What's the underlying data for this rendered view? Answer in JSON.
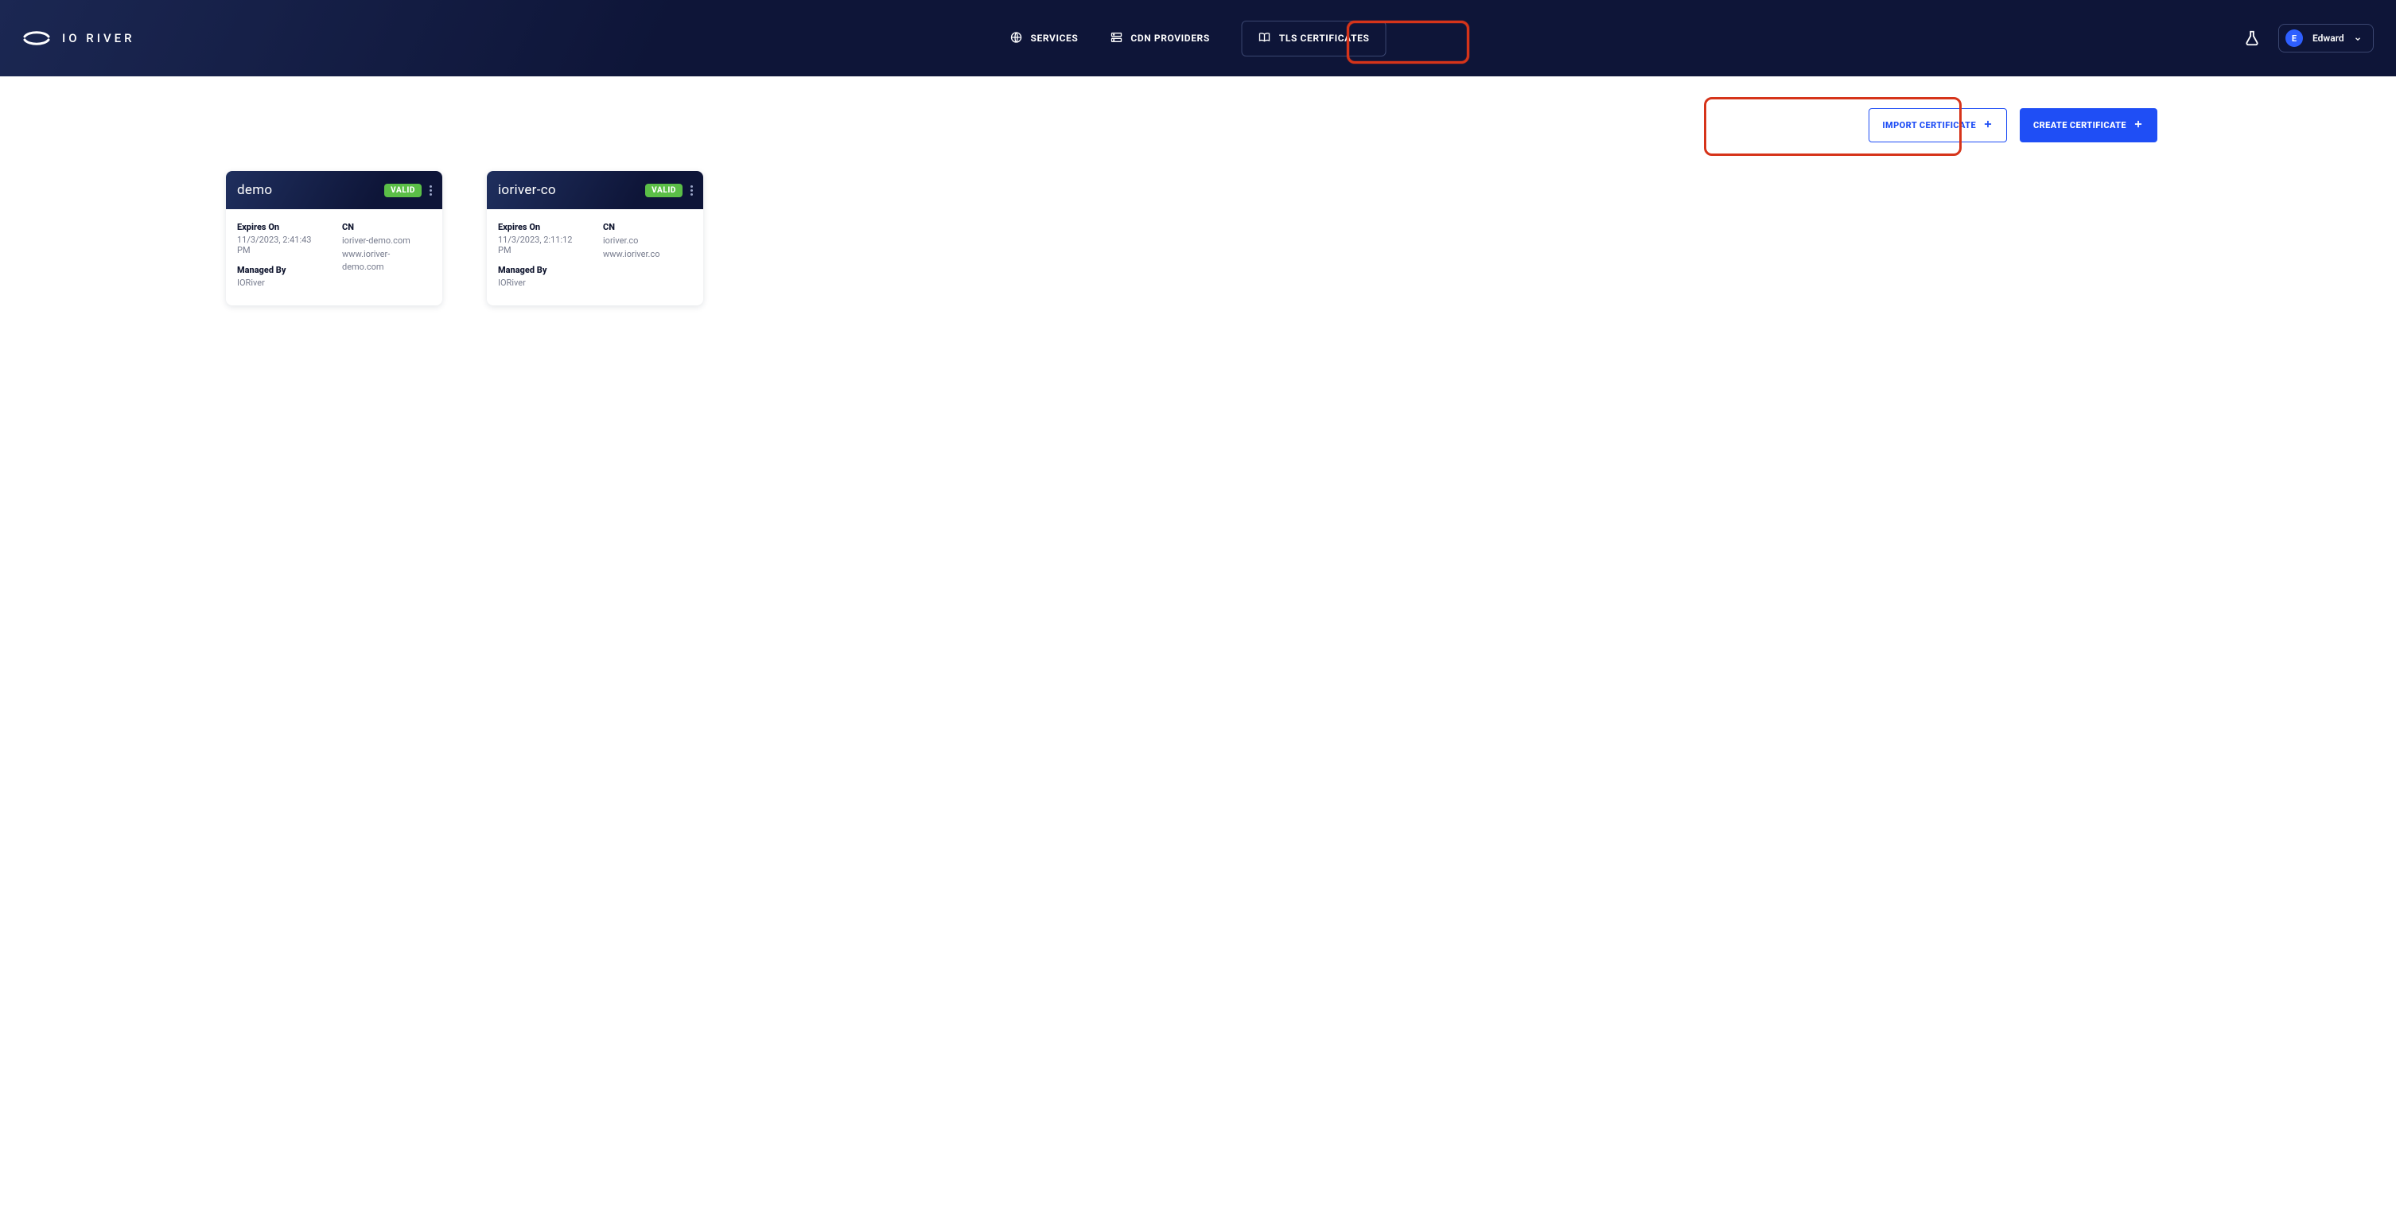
{
  "brand": {
    "name": "IO RIVER"
  },
  "nav": {
    "services": "SERVICES",
    "cdn_providers": "CDN PROVIDERS",
    "tls_certificates": "TLS CERTIFICATES"
  },
  "user": {
    "initial": "E",
    "name": "Edward"
  },
  "actions": {
    "import": "IMPORT CERTIFICATE",
    "create": "CREATE CERTIFICATE"
  },
  "labels": {
    "expires_on": "Expires On",
    "managed_by": "Managed By",
    "cn": "CN"
  },
  "certificates": [
    {
      "name": "demo",
      "status": "VALID",
      "expires": "11/3/2023, 2:41:43 PM",
      "managed_by": "IORiver",
      "cns": [
        "ioriver-demo.com",
        "www.ioriver-demo.com"
      ]
    },
    {
      "name": "ioriver-co",
      "status": "VALID",
      "expires": "11/3/2023, 2:11:12 PM",
      "managed_by": "IORiver",
      "cns": [
        "ioriver.co",
        "www.ioriver.co"
      ]
    }
  ],
  "highlights": {
    "tls_tab": true,
    "action_buttons": true
  }
}
